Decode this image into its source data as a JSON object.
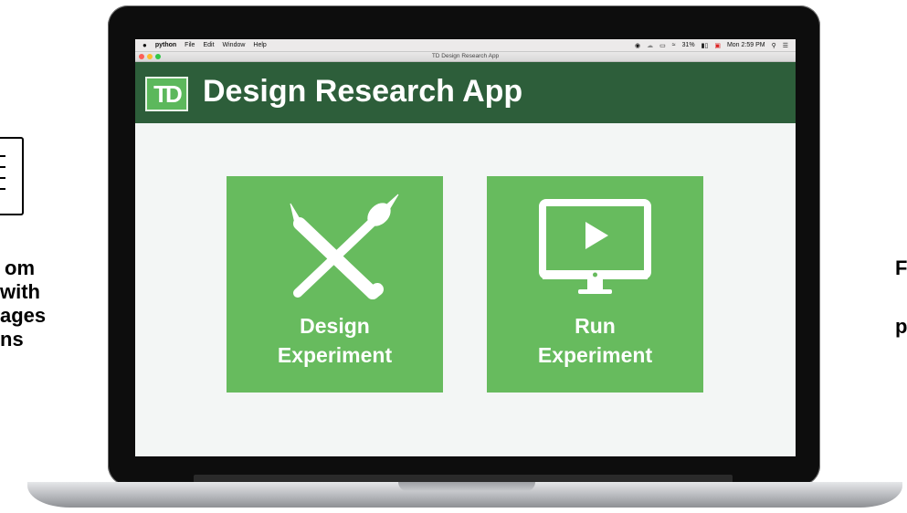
{
  "left_panel": {
    "text_lines": [
      "om",
      "with",
      "ages",
      "ns"
    ]
  },
  "right_panel": {
    "text_lines": [
      "F",
      "p"
    ]
  },
  "menubar": {
    "app_name": "python",
    "items": [
      "File",
      "Edit",
      "Window",
      "Help"
    ],
    "battery": "31%",
    "clock": "Mon 2:59 PM"
  },
  "window": {
    "title": "TD Design Research App"
  },
  "app": {
    "logo_text": "TD",
    "title": "Design Research App",
    "header_color": "#2d5e3a",
    "tile_color": "#67bb5e",
    "tiles": [
      {
        "line1": "Design",
        "line2": "Experiment",
        "icon": "pencil-brush-icon"
      },
      {
        "line1": "Run",
        "line2": "Experiment",
        "icon": "monitor-play-icon"
      }
    ]
  }
}
